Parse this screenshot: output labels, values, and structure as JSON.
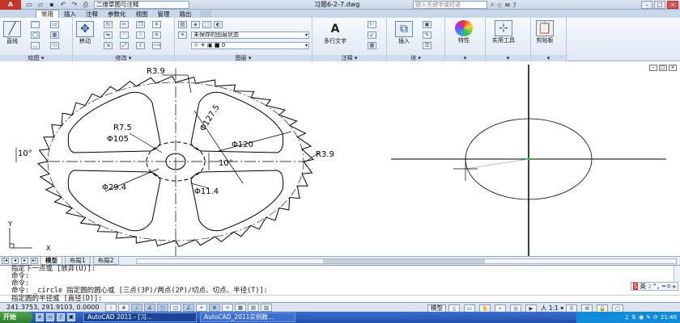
{
  "title_bar": {
    "app_logo": "A",
    "workspace": "二维草图与注释",
    "document": "习题6-2-7.dwg",
    "help_search_placeholder": "键入关键字或短语",
    "window_buttons": [
      "–",
      "□",
      "×"
    ]
  },
  "ribbon": {
    "tabs": [
      "常用",
      "插入",
      "注释",
      "参数化",
      "视图",
      "管理",
      "输出"
    ],
    "active_tab": "常用",
    "panels": {
      "draw": {
        "footer": "绘图 ▾",
        "line_label": "直线"
      },
      "modify": {
        "footer": "修改 ▾",
        "move_label": "移动"
      },
      "layers": {
        "footer": "图层 ▾",
        "layer_state": "未保存的图层状态",
        "current_layer": "0"
      },
      "annotation": {
        "footer": "注释 ▾",
        "mtext_label": "多行文字"
      },
      "block": {
        "footer": "块 ▾",
        "insert_label": "插入"
      },
      "properties": {
        "label": "特性"
      },
      "utilities": {
        "label": "实用工具"
      },
      "clipboard": {
        "label": "剪贴板"
      }
    }
  },
  "drawing": {
    "dimensions": {
      "r_top": "R3.9",
      "phi_127_5": "Φ127.5",
      "r7_5": "R7.5",
      "phi105": "Φ105",
      "phi120": "Φ120",
      "angle_left": "10°",
      "angle_center": "10°",
      "r_right": "R3.9",
      "phi29_4": "Φ29.4",
      "phi11_4": "Φ11.4"
    },
    "ucs": {
      "x": "X",
      "y": "Y"
    }
  },
  "layout_tabs": [
    "模型",
    "布局1",
    "布局2"
  ],
  "command_window": {
    "lines": [
      "指定下一点或 [放弃(U)]:",
      "命令:",
      "命令:",
      "命令: _circle 指定圆的圆心或 [三点(3P)/两点(2P)/切点、切点、半径(T)]:"
    ],
    "prompt": "指定圆的半径或 [直径(D)]:",
    "ime": {
      "logo": "S",
      "lang": "英"
    }
  },
  "status_bar": {
    "coordinates": "241.3753, 291.9103, 0.0000",
    "model_label": "模型",
    "annotation_scale": "人 1:1 ▾"
  },
  "taskbar": {
    "start": "开始",
    "tasks": [
      "AutoCAD 2011 - [习...",
      "AutoCAD_2011实例教..."
    ],
    "clock": "21:40"
  }
}
